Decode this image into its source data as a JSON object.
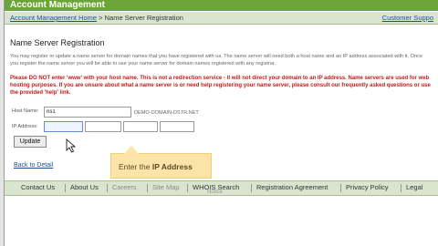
{
  "header": {
    "title": "Account Management"
  },
  "nav": {
    "breadcrumb_link": "Account Management Home",
    "breadcrumb_sep": " > ",
    "breadcrumb_current": "Name Server Registration",
    "support_link": "Customer Suppo"
  },
  "main": {
    "heading": "Name Server Registration",
    "intro": "You may register or update a name server for domain names that you have registered with us. The name server will need both a host name and an IP address associated with it. Once you register the name server you will be able to use your name server for domain names registered with any registrar.",
    "warning": "Please DO NOT enter 'www' with your host name. This is not a redirection service - it will not direct your domain to an IP address. Name servers are used for web hosting purposes. If you are unsure about what a name server is or need help registering your name server, please consult our frequently asked questions or use the provided 'help' link."
  },
  "form": {
    "host_label": "Host Name:",
    "host_value": "ns1",
    "domain_suffix": "DEMO-DOMAIN-DSTR.NET",
    "ip_label": "IP Address:",
    "ip_values": [
      "",
      "",
      "",
      ""
    ],
    "update_button": "Update"
  },
  "back_link": "Back to Detail",
  "tooltip": {
    "prefix": "Enter the ",
    "bold": "IP Address"
  },
  "footer": {
    "items": [
      "Contact Us",
      "About Us",
      "Careers",
      "Site Map",
      "WHOIS Search",
      "Registration Agreement",
      "Privacy Policy",
      "Legal"
    ],
    "note": "Notice"
  },
  "colors": {
    "brand_green": "#6ba539",
    "warning_red": "#c21b1b",
    "link_blue": "#1a4f96",
    "tooltip_bg": "#fce3a8"
  }
}
